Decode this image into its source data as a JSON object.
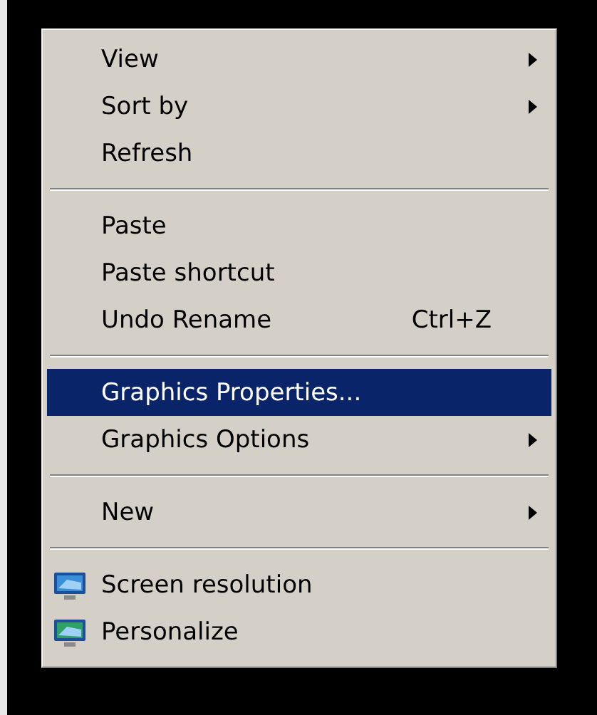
{
  "menu": {
    "groups": [
      {
        "items": [
          {
            "kind": "plain",
            "label": "View",
            "submenu": true,
            "selected": false
          },
          {
            "kind": "plain",
            "label": "Sort by",
            "submenu": true,
            "selected": false
          },
          {
            "kind": "plain",
            "label": "Refresh",
            "submenu": false,
            "selected": false
          }
        ]
      },
      {
        "items": [
          {
            "kind": "plain",
            "label": "Paste",
            "submenu": false,
            "selected": false
          },
          {
            "kind": "plain",
            "label": "Paste shortcut",
            "submenu": false,
            "selected": false
          },
          {
            "kind": "plain",
            "label": "Undo Rename",
            "shortcut": "Ctrl+Z",
            "submenu": false,
            "selected": false
          }
        ]
      },
      {
        "items": [
          {
            "kind": "plain",
            "label": "Graphics Properties...",
            "submenu": false,
            "selected": true
          },
          {
            "kind": "plain",
            "label": "Graphics Options",
            "submenu": true,
            "selected": false
          }
        ]
      },
      {
        "items": [
          {
            "kind": "plain",
            "label": "New",
            "submenu": true,
            "selected": false
          }
        ]
      },
      {
        "items": [
          {
            "kind": "with_icon",
            "label": "Screen resolution",
            "submenu": false,
            "selected": false
          },
          {
            "kind": "with_icon",
            "label": "Personalize",
            "submenu": false,
            "selected": false
          }
        ]
      }
    ]
  }
}
